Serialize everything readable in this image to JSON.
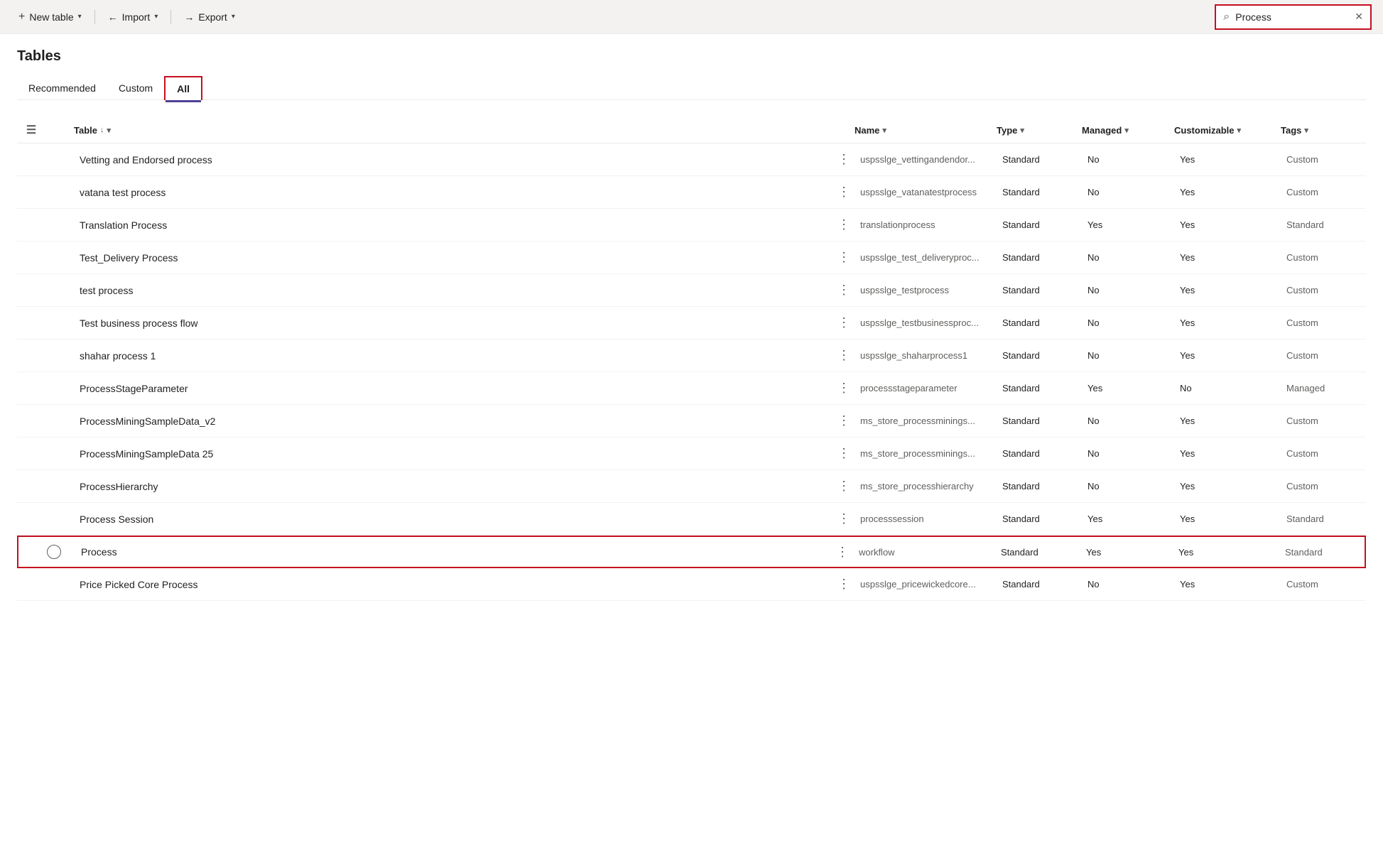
{
  "toolbar": {
    "new_table_label": "New table",
    "import_label": "Import",
    "export_label": "Export"
  },
  "search": {
    "value": "Process",
    "placeholder": "Search"
  },
  "page": {
    "title": "Tables"
  },
  "tabs": [
    {
      "id": "recommended",
      "label": "Recommended",
      "active": false
    },
    {
      "id": "custom",
      "label": "Custom",
      "active": false
    },
    {
      "id": "all",
      "label": "All",
      "active": true
    }
  ],
  "table": {
    "columns": [
      {
        "id": "table",
        "label": "Table",
        "sort": "↓",
        "filter": "▾"
      },
      {
        "id": "name",
        "label": "Name",
        "filter": "▾"
      },
      {
        "id": "type",
        "label": "Type",
        "filter": "▾"
      },
      {
        "id": "managed",
        "label": "Managed",
        "filter": "▾"
      },
      {
        "id": "customizable",
        "label": "Customizable",
        "filter": "▾"
      },
      {
        "id": "tags",
        "label": "Tags",
        "filter": "▾"
      }
    ],
    "rows": [
      {
        "id": 1,
        "table": "Vetting and Endorsed process",
        "name": "uspsslge_vettingandendor...",
        "type": "Standard",
        "managed": "No",
        "customizable": "Yes",
        "tags": "Custom",
        "selected": false
      },
      {
        "id": 2,
        "table": "vatana test process",
        "name": "uspsslge_vatanatestprocess",
        "type": "Standard",
        "managed": "No",
        "customizable": "Yes",
        "tags": "Custom",
        "selected": false
      },
      {
        "id": 3,
        "table": "Translation Process",
        "name": "translationprocess",
        "type": "Standard",
        "managed": "Yes",
        "customizable": "Yes",
        "tags": "Standard",
        "selected": false
      },
      {
        "id": 4,
        "table": "Test_Delivery Process",
        "name": "uspsslge_test_deliveryproc...",
        "type": "Standard",
        "managed": "No",
        "customizable": "Yes",
        "tags": "Custom",
        "selected": false
      },
      {
        "id": 5,
        "table": "test process",
        "name": "uspsslge_testprocess",
        "type": "Standard",
        "managed": "No",
        "customizable": "Yes",
        "tags": "Custom",
        "selected": false
      },
      {
        "id": 6,
        "table": "Test business process flow",
        "name": "uspsslge_testbusinessproc...",
        "type": "Standard",
        "managed": "No",
        "customizable": "Yes",
        "tags": "Custom",
        "selected": false
      },
      {
        "id": 7,
        "table": "shahar process 1",
        "name": "uspsslge_shaharprocess1",
        "type": "Standard",
        "managed": "No",
        "customizable": "Yes",
        "tags": "Custom",
        "selected": false
      },
      {
        "id": 8,
        "table": "ProcessStageParameter",
        "name": "processstageparameter",
        "type": "Standard",
        "managed": "Yes",
        "customizable": "No",
        "tags": "Managed",
        "selected": false
      },
      {
        "id": 9,
        "table": "ProcessMiningSampleData_v2",
        "name": "ms_store_processminings...",
        "type": "Standard",
        "managed": "No",
        "customizable": "Yes",
        "tags": "Custom",
        "selected": false
      },
      {
        "id": 10,
        "table": "ProcessMiningSampleData 25",
        "name": "ms_store_processminings...",
        "type": "Standard",
        "managed": "No",
        "customizable": "Yes",
        "tags": "Custom",
        "selected": false
      },
      {
        "id": 11,
        "table": "ProcessHierarchy",
        "name": "ms_store_processhierarchy",
        "type": "Standard",
        "managed": "No",
        "customizable": "Yes",
        "tags": "Custom",
        "selected": false
      },
      {
        "id": 12,
        "table": "Process Session",
        "name": "processsession",
        "type": "Standard",
        "managed": "Yes",
        "customizable": "Yes",
        "tags": "Standard",
        "selected": false
      },
      {
        "id": 13,
        "table": "Process",
        "name": "workflow",
        "type": "Standard",
        "managed": "Yes",
        "customizable": "Yes",
        "tags": "Standard",
        "selected": true
      },
      {
        "id": 14,
        "table": "Price Picked Core Process",
        "name": "uspsslge_pricewickedcore...",
        "type": "Standard",
        "managed": "No",
        "customizable": "Yes",
        "tags": "Custom",
        "selected": false
      }
    ]
  }
}
